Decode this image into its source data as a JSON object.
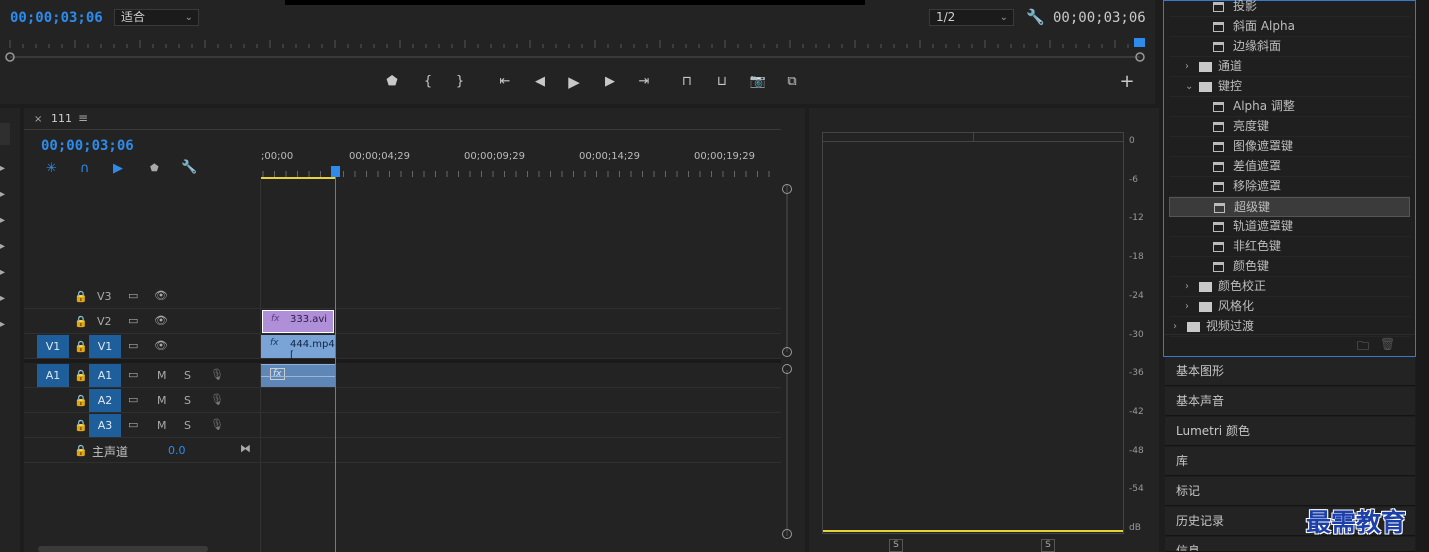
{
  "program_monitor": {
    "timecode": "00;00;03;06",
    "fit_select": "适合",
    "resolution_select": "1/2",
    "timecode_right": "00;00;03;06"
  },
  "timeline": {
    "sequence_tab": "111",
    "timecode": "00;00;03;06",
    "ruler_labels": [
      ";00;00",
      "00;00;04;29",
      "00;00;09;29",
      "00;00;14;29",
      "00;00;19;29"
    ],
    "tracks": {
      "v3": "V3",
      "v2": "V2",
      "v1": "V1",
      "v1_source": "V1",
      "a1": "A1",
      "a2": "A2",
      "a3": "A3",
      "a1_source": "A1",
      "m": "M",
      "s": "S"
    },
    "master_label": "主声道",
    "master_value": "0.0",
    "clips": {
      "v2_clip": "333.avi",
      "v1_clip": "444.mp4 [",
      "fx": "fx"
    }
  },
  "audio_meter": {
    "scale": [
      "0",
      "-6",
      "-12",
      "-18",
      "-24",
      "-30",
      "-36",
      "-42",
      "-48",
      "-54",
      "dB"
    ],
    "solo_left": "S",
    "solo_right": "S"
  },
  "effects_panel": {
    "items": [
      {
        "label": "投影",
        "type": "effect"
      },
      {
        "label": "斜面 Alpha",
        "type": "effect"
      },
      {
        "label": "边缘斜面",
        "type": "effect"
      },
      {
        "label": "通道",
        "type": "folder"
      },
      {
        "label": "键控",
        "type": "folder-open"
      },
      {
        "label": "Alpha 调整",
        "type": "effect"
      },
      {
        "label": "亮度键",
        "type": "effect"
      },
      {
        "label": "图像遮罩键",
        "type": "effect"
      },
      {
        "label": "差值遮罩",
        "type": "effect"
      },
      {
        "label": "移除遮罩",
        "type": "effect"
      },
      {
        "label": "超级键",
        "type": "effect",
        "selected": true
      },
      {
        "label": "轨道遮罩键",
        "type": "effect"
      },
      {
        "label": "非红色键",
        "type": "effect"
      },
      {
        "label": "颜色键",
        "type": "effect"
      },
      {
        "label": "颜色校正",
        "type": "folder"
      },
      {
        "label": "风格化",
        "type": "folder"
      },
      {
        "label": "视频过渡",
        "type": "folder-root"
      }
    ]
  },
  "panels": [
    "基本图形",
    "基本声音",
    "Lumetri 颜色",
    "库",
    "标记",
    "历史记录",
    "信息"
  ],
  "watermark": "最需教育",
  "colors": {
    "accent": "#2d8ceb",
    "track_blue": "#1e5e9a",
    "v2_clip": "#b08fd9",
    "v1_clip": "#7aa4d6",
    "audio_clip": "#5e87b8",
    "selection_border": "#3a78c9"
  }
}
